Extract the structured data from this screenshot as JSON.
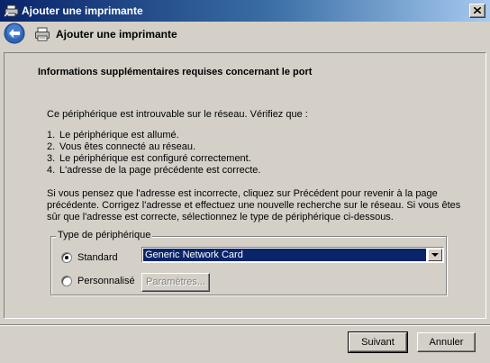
{
  "window": {
    "title": "Ajouter une imprimante"
  },
  "header": {
    "title": "Ajouter une imprimante"
  },
  "content": {
    "heading": "Informations supplémentaires requises concernant le port",
    "intro": "Ce périphérique est introuvable sur le réseau. Vérifiez que :",
    "checks": [
      {
        "num": "1.",
        "text": "Le périphérique est allumé."
      },
      {
        "num": "2.",
        "text": "Vous êtes connecté au réseau."
      },
      {
        "num": "3.",
        "text": "Le périphérique est configuré correctement."
      },
      {
        "num": "4.",
        "text": "L'adresse de la page précédente est correcte."
      }
    ],
    "note_lines": [
      "Si vous pensez que l'adresse est incorrecte, cliquez sur Précédent pour revenir à la page",
      "précédente. Corrigez l'adresse et effectuez une nouvelle recherche sur le réseau. Si vous êtes",
      "sûr que l'adresse est correcte, sélectionnez le type de périphérique ci-dessous."
    ]
  },
  "device_type": {
    "legend": "Type de périphérique",
    "standard_label": "Standard",
    "standard_selected": true,
    "combo_value": "Generic Network Card",
    "custom_label": "Personnalisé",
    "custom_selected": false,
    "settings_button": "Paramètres..."
  },
  "footer": {
    "next_button": "Suivant",
    "cancel_button": "Annuler"
  },
  "colors": {
    "title_bar": "#0a246a",
    "face": "#d4d0c8",
    "selection": "#0a246a"
  }
}
